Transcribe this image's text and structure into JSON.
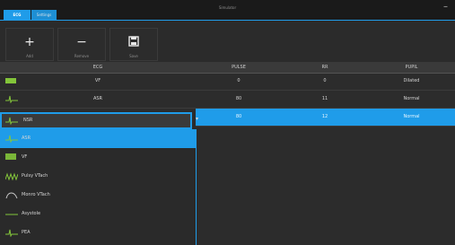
{
  "window": {
    "title": "Simulator",
    "tabs": [
      {
        "label": "ECG"
      },
      {
        "label": "Settings"
      }
    ],
    "control": "–"
  },
  "toolbar": {
    "buttons": [
      {
        "label": "Add",
        "glyph": "+"
      },
      {
        "label": "Remove",
        "glyph": "−"
      },
      {
        "label": "Save",
        "glyph": "💾"
      }
    ]
  },
  "grid": {
    "columns": [
      "ECG",
      "PULSE",
      "RR",
      "PUPIL"
    ],
    "rows": [
      {
        "ecg": "VF",
        "pulse": "0",
        "rr": "0",
        "pupil": "Dilated"
      },
      {
        "ecg": "ASR",
        "pulse": "80",
        "rr": "11",
        "pupil": "Normal"
      },
      {
        "ecg": "NSR",
        "pulse": "80",
        "rr": "12",
        "pupil": "Normal"
      }
    ]
  },
  "dropdown": {
    "selected": "NSR",
    "items": [
      "ASR",
      "VF",
      "Pulsy VTach",
      "Monro VTach",
      "Asystole",
      "PEA"
    ]
  },
  "colors": {
    "accent": "#1f9ce9",
    "green": "#83c53a"
  }
}
